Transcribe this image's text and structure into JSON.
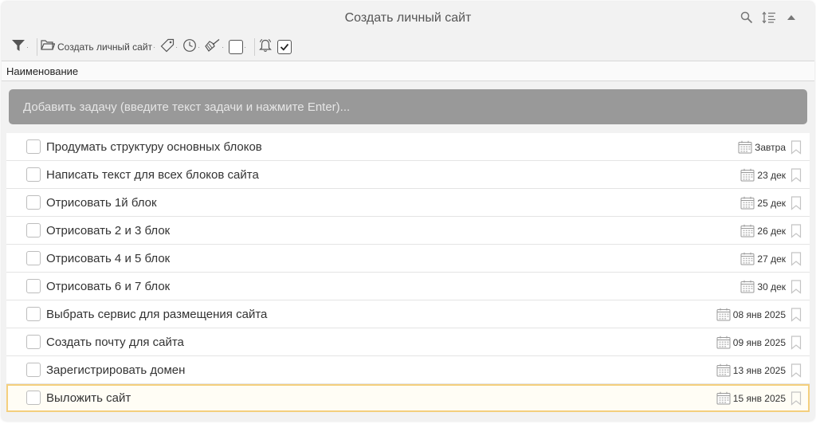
{
  "window": {
    "title": "Создать личный сайт"
  },
  "toolbar": {
    "project_label": "Создать личный сайт"
  },
  "columns": {
    "name_header": "Наименование"
  },
  "add_task": {
    "placeholder": "Добавить задачу (введите текст задачи и нажмите Enter)..."
  },
  "tasks": [
    {
      "name": "Продумать структуру основных блоков",
      "date": "Завтра",
      "completed": false
    },
    {
      "name": "Написать текст для всех блоков сайта",
      "date": "23 дек",
      "completed": false
    },
    {
      "name": "Отрисовать 1й блок",
      "date": "25 дек",
      "completed": false
    },
    {
      "name": "Отрисовать 2 и 3 блок",
      "date": "26 дек",
      "completed": false
    },
    {
      "name": "Отрисовать 4 и 5 блок",
      "date": "27 дек",
      "completed": false
    },
    {
      "name": "Отрисовать 6 и 7 блок",
      "date": "30 дек",
      "completed": false
    },
    {
      "name": "Выбрать сервис для размещения сайта",
      "date": "08 янв 2025",
      "completed": false
    },
    {
      "name": "Создать почту для сайта",
      "date": "09 янв 2025",
      "completed": false
    },
    {
      "name": "Зарегистрировать домен",
      "date": "13 янв 2025",
      "completed": false
    },
    {
      "name": "Выложить сайт",
      "date": "15 янв 2025",
      "completed": false,
      "selected": true
    }
  ],
  "colors": {
    "selected_outline": "#f4cf7e",
    "add_task_bg": "#999999"
  },
  "icons": [
    "search-icon",
    "sort-icon",
    "collapse-icon",
    "filter-icon",
    "folder-icon",
    "tag-icon",
    "clock-icon",
    "broom-icon",
    "checkbox-icon",
    "alarm-icon",
    "checked-box-icon",
    "calendar-icon",
    "bookmark-icon"
  ]
}
